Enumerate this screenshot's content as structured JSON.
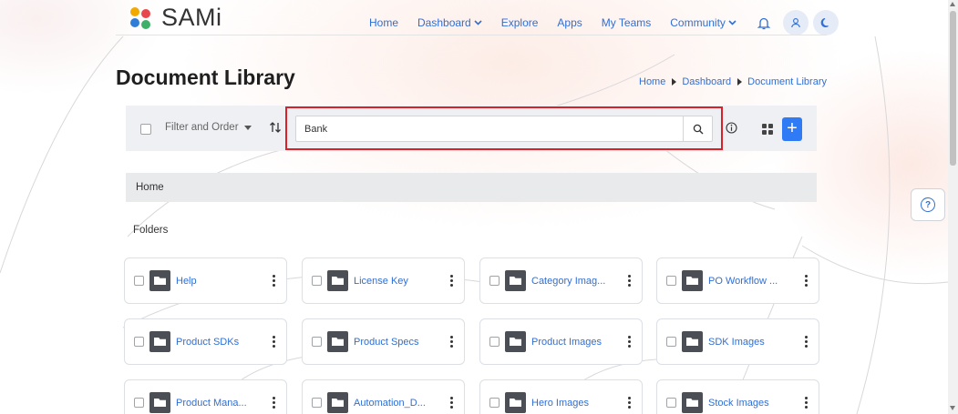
{
  "app": {
    "brand": "SAMi"
  },
  "nav": {
    "items": [
      "Home",
      "Dashboard",
      "Explore",
      "Apps",
      "My Teams",
      "Community"
    ],
    "icons": [
      "bell-icon",
      "user-icon",
      "moon-icon"
    ]
  },
  "page": {
    "title": "Document Library"
  },
  "breadcrumb": [
    "Home",
    "Dashboard",
    "Document Library"
  ],
  "toolbar": {
    "filter_label": "Filter and Order",
    "search_value": "Bank",
    "add_label": "+"
  },
  "home_bar": {
    "label": "Home"
  },
  "folders": {
    "label": "Folders",
    "items": [
      "Help",
      "License Key",
      "Category Imag...",
      "PO Workflow ...",
      "Product SDKs",
      "Product Specs",
      "Product Images",
      "SDK Images",
      "Product Mana...",
      "Automation_D...",
      "Hero Images",
      "Stock Images"
    ]
  },
  "colors": {
    "accent": "#2f6fd6",
    "add_button": "#2f7bf5",
    "search_highlight": "#d9212a",
    "folder_icon": "#4b4f55"
  }
}
